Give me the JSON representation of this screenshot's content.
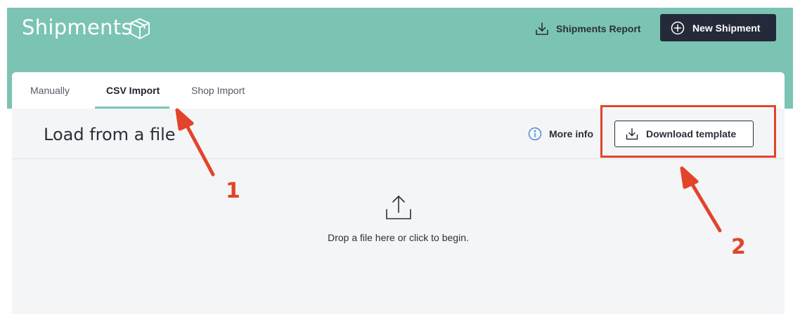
{
  "header": {
    "title": "Shipments",
    "report_label": "Shipments Report",
    "new_label": "New Shipment",
    "band_color": "#7bc4b4"
  },
  "tabs": [
    {
      "label": "Manually",
      "active": false
    },
    {
      "label": "CSV Import",
      "active": true
    },
    {
      "label": "Shop Import",
      "active": false
    }
  ],
  "section": {
    "title": "Load from a file",
    "more_info_label": "More info",
    "download_label": "Download template"
  },
  "dropzone": {
    "text": "Drop a file here or click to begin."
  },
  "annotations": [
    {
      "number": "1",
      "color": "#e2442a"
    },
    {
      "number": "2",
      "color": "#e2442a"
    }
  ],
  "icons": [
    "box-icon",
    "download-icon",
    "plus-circle-icon",
    "info-icon",
    "upload-icon"
  ]
}
